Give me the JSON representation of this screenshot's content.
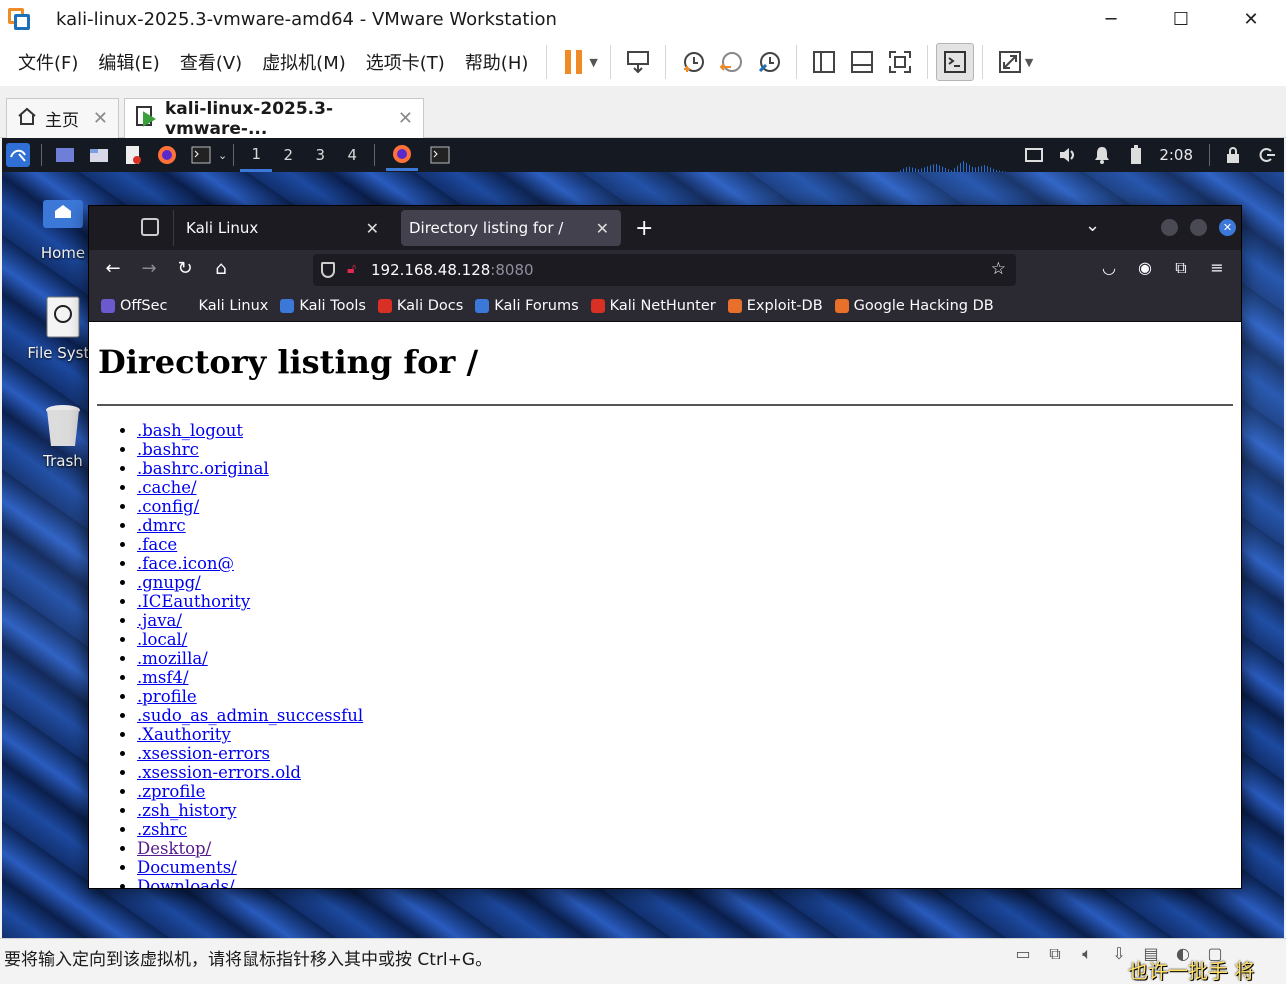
{
  "vmware": {
    "title": "kali-linux-2025.3-vmware-amd64 - VMware Workstation",
    "window_controls": {
      "minimize": "─",
      "maximize": "☐",
      "close": "✕"
    },
    "menu": [
      "文件(F)",
      "编辑(E)",
      "查看(V)",
      "虚拟机(M)",
      "选项卡(T)",
      "帮助(H)"
    ],
    "tabs": [
      {
        "label": "主页",
        "close": "✕"
      },
      {
        "label": "kali-linux-2025.3-vmware-...",
        "close": "✕"
      }
    ],
    "status_message": "要将输入定向到该虚拟机，请将鼠标指针移入其中或按 Ctrl+G。",
    "ime_text": "也许一批手 将"
  },
  "kali": {
    "workspaces": [
      "1",
      "2",
      "3",
      "4"
    ],
    "clock": "2:08",
    "desktop_icons": [
      {
        "label": "Home"
      },
      {
        "label": "File Syste"
      },
      {
        "label": "Trash"
      }
    ]
  },
  "firefox": {
    "tabs": [
      {
        "label": "Kali Linux",
        "close": "✕"
      },
      {
        "label": "Directory listing for /",
        "close": "✕"
      }
    ],
    "new_tab": "+",
    "url_host": "192.168.48.128",
    "url_port": ":8080",
    "bookmarks": [
      {
        "label": "OffSec",
        "color": "#6a5acd"
      },
      {
        "label": "Kali Linux",
        "color": "#2b2a33"
      },
      {
        "label": "Kali Tools",
        "color": "#3c78d8"
      },
      {
        "label": "Kali Docs",
        "color": "#d93025"
      },
      {
        "label": "Kali Forums",
        "color": "#3c78d8"
      },
      {
        "label": "Kali NetHunter",
        "color": "#d93025"
      },
      {
        "label": "Exploit-DB",
        "color": "#e8702a"
      },
      {
        "label": "Google Hacking DB",
        "color": "#e8702a"
      }
    ]
  },
  "page": {
    "heading": "Directory listing for /",
    "entries": [
      ".bash_logout",
      ".bashrc",
      ".bashrc.original",
      ".cache/",
      ".config/",
      ".dmrc",
      ".face",
      ".face.icon@",
      ".gnupg/",
      ".ICEauthority",
      ".java/",
      ".local/",
      ".mozilla/",
      ".msf4/",
      ".profile",
      ".sudo_as_admin_successful",
      ".Xauthority",
      ".xsession-errors",
      ".xsession-errors.old",
      ".zprofile",
      ".zsh_history",
      ".zshrc",
      "Desktop/",
      "Documents/",
      "Downloads/"
    ],
    "visited_entry": "Desktop/"
  },
  "colors": {
    "link": "#0000ee",
    "visited_link": "#551a8b",
    "kali_panel": "#151a22",
    "firefox_chrome": "#2b2a33",
    "vmware_pause": "#f08a24"
  }
}
